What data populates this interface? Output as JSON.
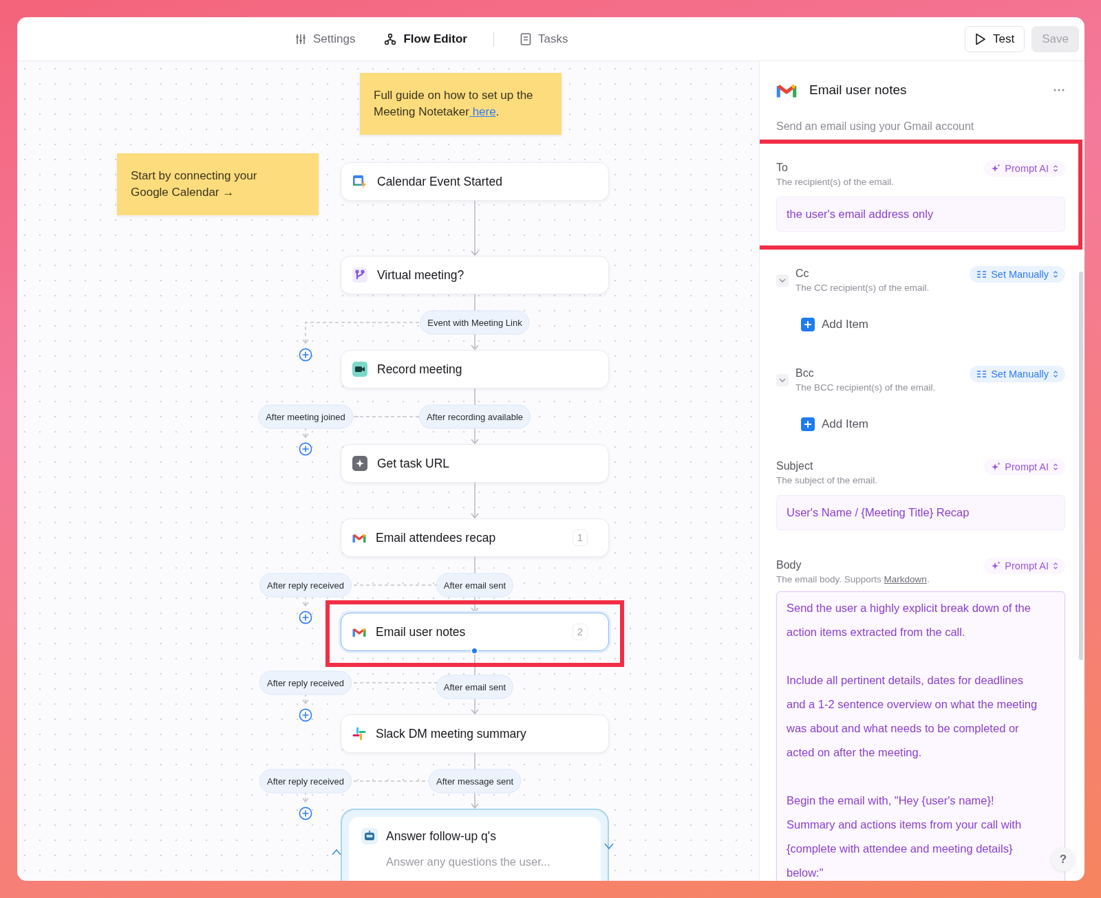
{
  "tabs": [
    {
      "kind": "settings",
      "label": "Settings",
      "selected": false,
      "divider_before": false
    },
    {
      "kind": "flow",
      "label": "Flow Editor",
      "selected": true,
      "divider_before": false
    },
    {
      "kind": "tasks",
      "label": "Tasks",
      "selected": false,
      "divider_before": true
    }
  ],
  "actions": [
    {
      "kind": "test",
      "label": "Test",
      "disabled": false
    },
    {
      "kind": "save",
      "label": "Save",
      "disabled": true
    }
  ],
  "notes": [
    {
      "kind": "guide",
      "text": "Full guide on how to set up the Meeting Notetaker",
      "link": " here",
      "tail": "."
    },
    {
      "kind": "start",
      "text": "Start by connecting your Google Calendar →"
    }
  ],
  "nodes": [
    {
      "kind": "calendar",
      "title": "Calendar Event Started",
      "selected": false,
      "highlighted": false
    },
    {
      "kind": "branch",
      "title": "Virtual meeting?",
      "selected": false,
      "highlighted": false,
      "branch": {
        "main": "Event with Meeting Link"
      }
    },
    {
      "kind": "video",
      "title": "Record meeting",
      "selected": false,
      "highlighted": false,
      "branch": {
        "main": "After recording available",
        "side": "After meeting joined"
      }
    },
    {
      "kind": "sparkle",
      "title": "Get task URL",
      "selected": false,
      "highlighted": false
    },
    {
      "kind": "gmail",
      "title": "Email attendees recap",
      "count": "1",
      "selected": false,
      "highlighted": false,
      "branch": {
        "main": "After email sent",
        "side": "After reply received"
      }
    },
    {
      "kind": "gmail",
      "title": "Email user notes",
      "count": "2",
      "selected": true,
      "highlighted": true,
      "branch": {
        "main": "After email sent",
        "side": "After reply received"
      }
    },
    {
      "kind": "slack",
      "title": "Slack DM meeting summary",
      "selected": false,
      "highlighted": false,
      "branch": {
        "main": "After message sent",
        "side": "After reply received"
      }
    },
    {
      "kind": "bot",
      "title": "Answer follow-up q's",
      "subtitle": "Answer any questions the user...",
      "selected": false,
      "highlighted": false,
      "loop": true
    }
  ],
  "panel": {
    "title": "Email user notes",
    "subtitle": "Send an email using your Gmail account",
    "help": "?",
    "fields": [
      {
        "kind": "text",
        "label": "To",
        "description": "The recipient(s) of the email.",
        "mode": {
          "kind": "prompt_ai",
          "label": "Prompt AI"
        },
        "value": "the user's email address only",
        "highlighted": true
      },
      {
        "kind": "list",
        "label": "Cc",
        "description": "The CC recipient(s) of the email.",
        "mode": {
          "kind": "manual",
          "label": "Set Manually"
        },
        "add_label": "Add Item",
        "highlighted": false
      },
      {
        "kind": "list",
        "label": "Bcc",
        "description": "The BCC recipient(s) of the email.",
        "mode": {
          "kind": "manual",
          "label": "Set Manually"
        },
        "add_label": "Add Item",
        "highlighted": false
      },
      {
        "kind": "text",
        "label": "Subject",
        "description": "The subject of the email.",
        "mode": {
          "kind": "prompt_ai",
          "label": "Prompt AI"
        },
        "value": "User's Name / {Meeting Title} Recap",
        "highlighted": false
      },
      {
        "kind": "textarea",
        "label": "Body",
        "description": "The email body. Supports ",
        "description_link": "Markdown",
        "description_tail": ".",
        "mode": {
          "kind": "prompt_ai",
          "label": "Prompt AI"
        },
        "highlighted": false,
        "paragraphs": [
          "Send the user a highly explicit break down of the action items extracted from the call.",
          "Include all pertinent details, dates for deadlines and a 1-2 sentence overview on what the meeting was about and what needs to be completed or acted on after the meeting.",
          "Begin the email with, \"Hey {user's name}! Summary and actions items from your call with {complete with attendee and meeting details} below:\""
        ]
      }
    ]
  }
}
